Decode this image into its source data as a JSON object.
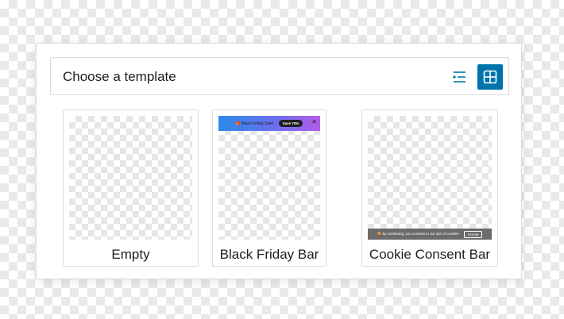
{
  "header": {
    "title": "Choose a template",
    "list_view_icon": "list-view-icon",
    "grid_view_icon": "grid-view-icon",
    "active_view": "grid"
  },
  "colors": {
    "accent": "#0073aa"
  },
  "templates": [
    {
      "label": "Empty"
    },
    {
      "label": "Black Friday Bar",
      "preview": {
        "text": "🎁 Black Friday Sale!",
        "button": "Save 70%",
        "close": "✕"
      }
    },
    {
      "label": "Cookie Consent Bar",
      "preview": {
        "text": "🍪 by continuing, you consent to our use of cookies",
        "button": "Accept"
      }
    }
  ]
}
